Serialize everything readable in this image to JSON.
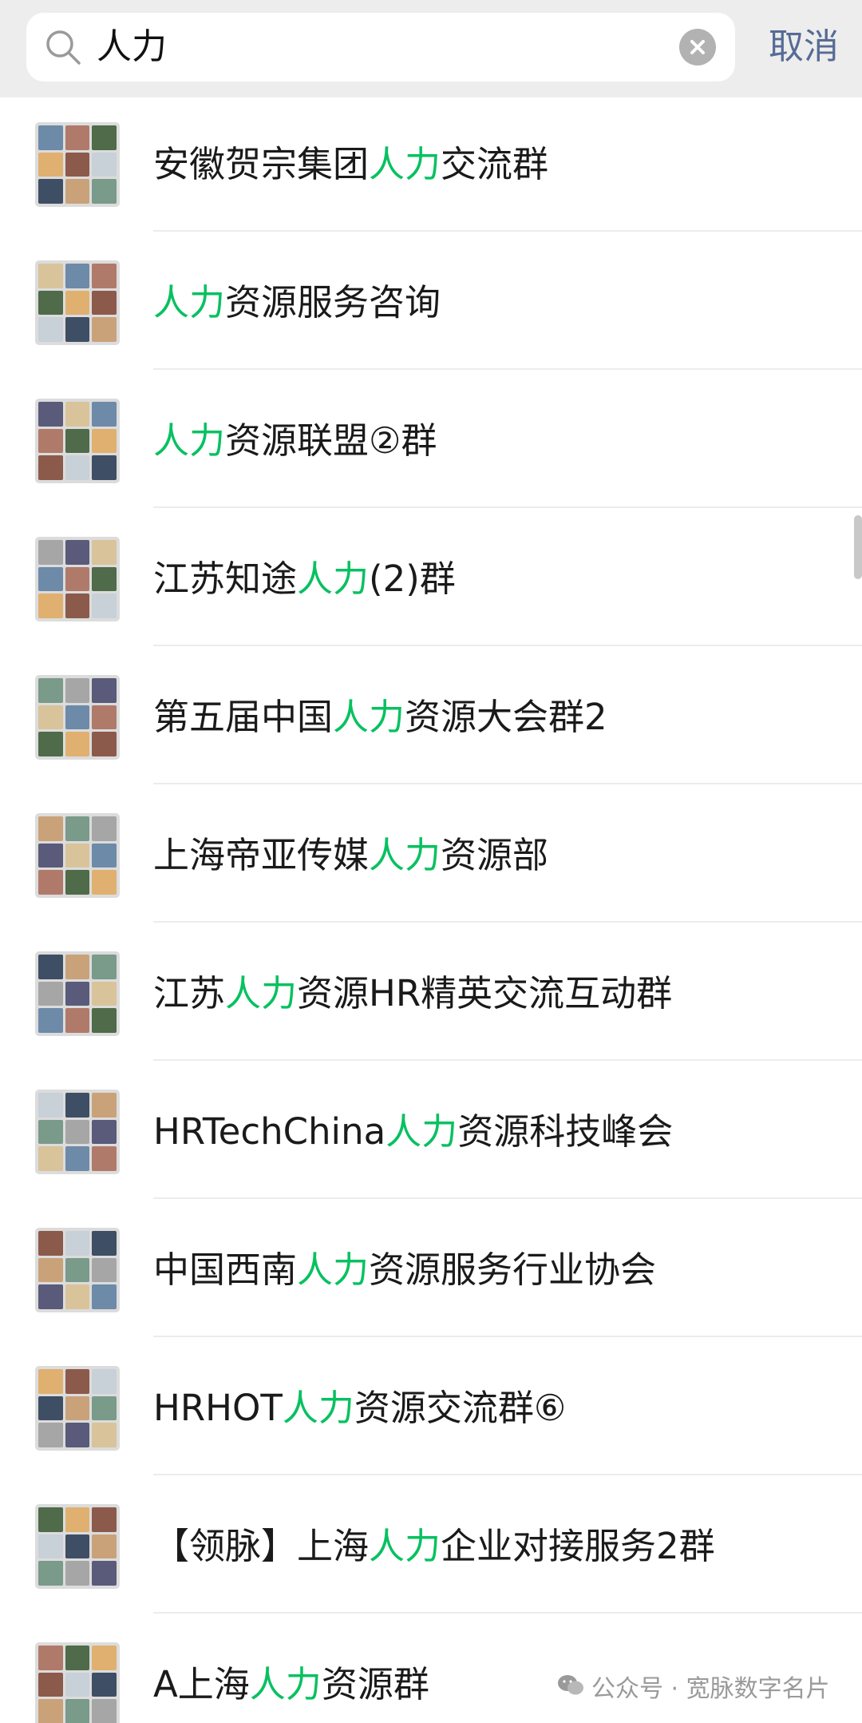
{
  "search": {
    "query": "人力",
    "cancel_label": "取消"
  },
  "results": [
    {
      "before": "安徽贺宗集团",
      "match": "人力",
      "after": "交流群"
    },
    {
      "before": "",
      "match": "人力",
      "after": "资源服务咨询"
    },
    {
      "before": "",
      "match": "人力",
      "after": "资源联盟②群"
    },
    {
      "before": "江苏知途",
      "match": "人力",
      "after": "(2)群"
    },
    {
      "before": "第五届中国",
      "match": "人力",
      "after": "资源大会群2"
    },
    {
      "before": "上海帝亚传媒",
      "match": "人力",
      "after": "资源部"
    },
    {
      "before": "江苏",
      "match": "人力",
      "after": "资源HR精英交流互动群"
    },
    {
      "before": "HRTechChina",
      "match": "人力",
      "after": "资源科技峰会"
    },
    {
      "before": "中国西南",
      "match": "人力",
      "after": "资源服务行业协会"
    },
    {
      "before": "HRHOT",
      "match": "人力",
      "after": "资源交流群⑥"
    },
    {
      "before": "【领脉】上海",
      "match": "人力",
      "after": "企业对接服务2群"
    },
    {
      "before": "A上海",
      "match": "人力",
      "after": "资源群"
    }
  ],
  "watermark": {
    "text": "公众号 · 宽脉数字名片",
    "icon": "wechat-icon"
  },
  "colors": {
    "highlight": "#07c160",
    "cancel": "#576b95",
    "topbar": "#ededed"
  }
}
